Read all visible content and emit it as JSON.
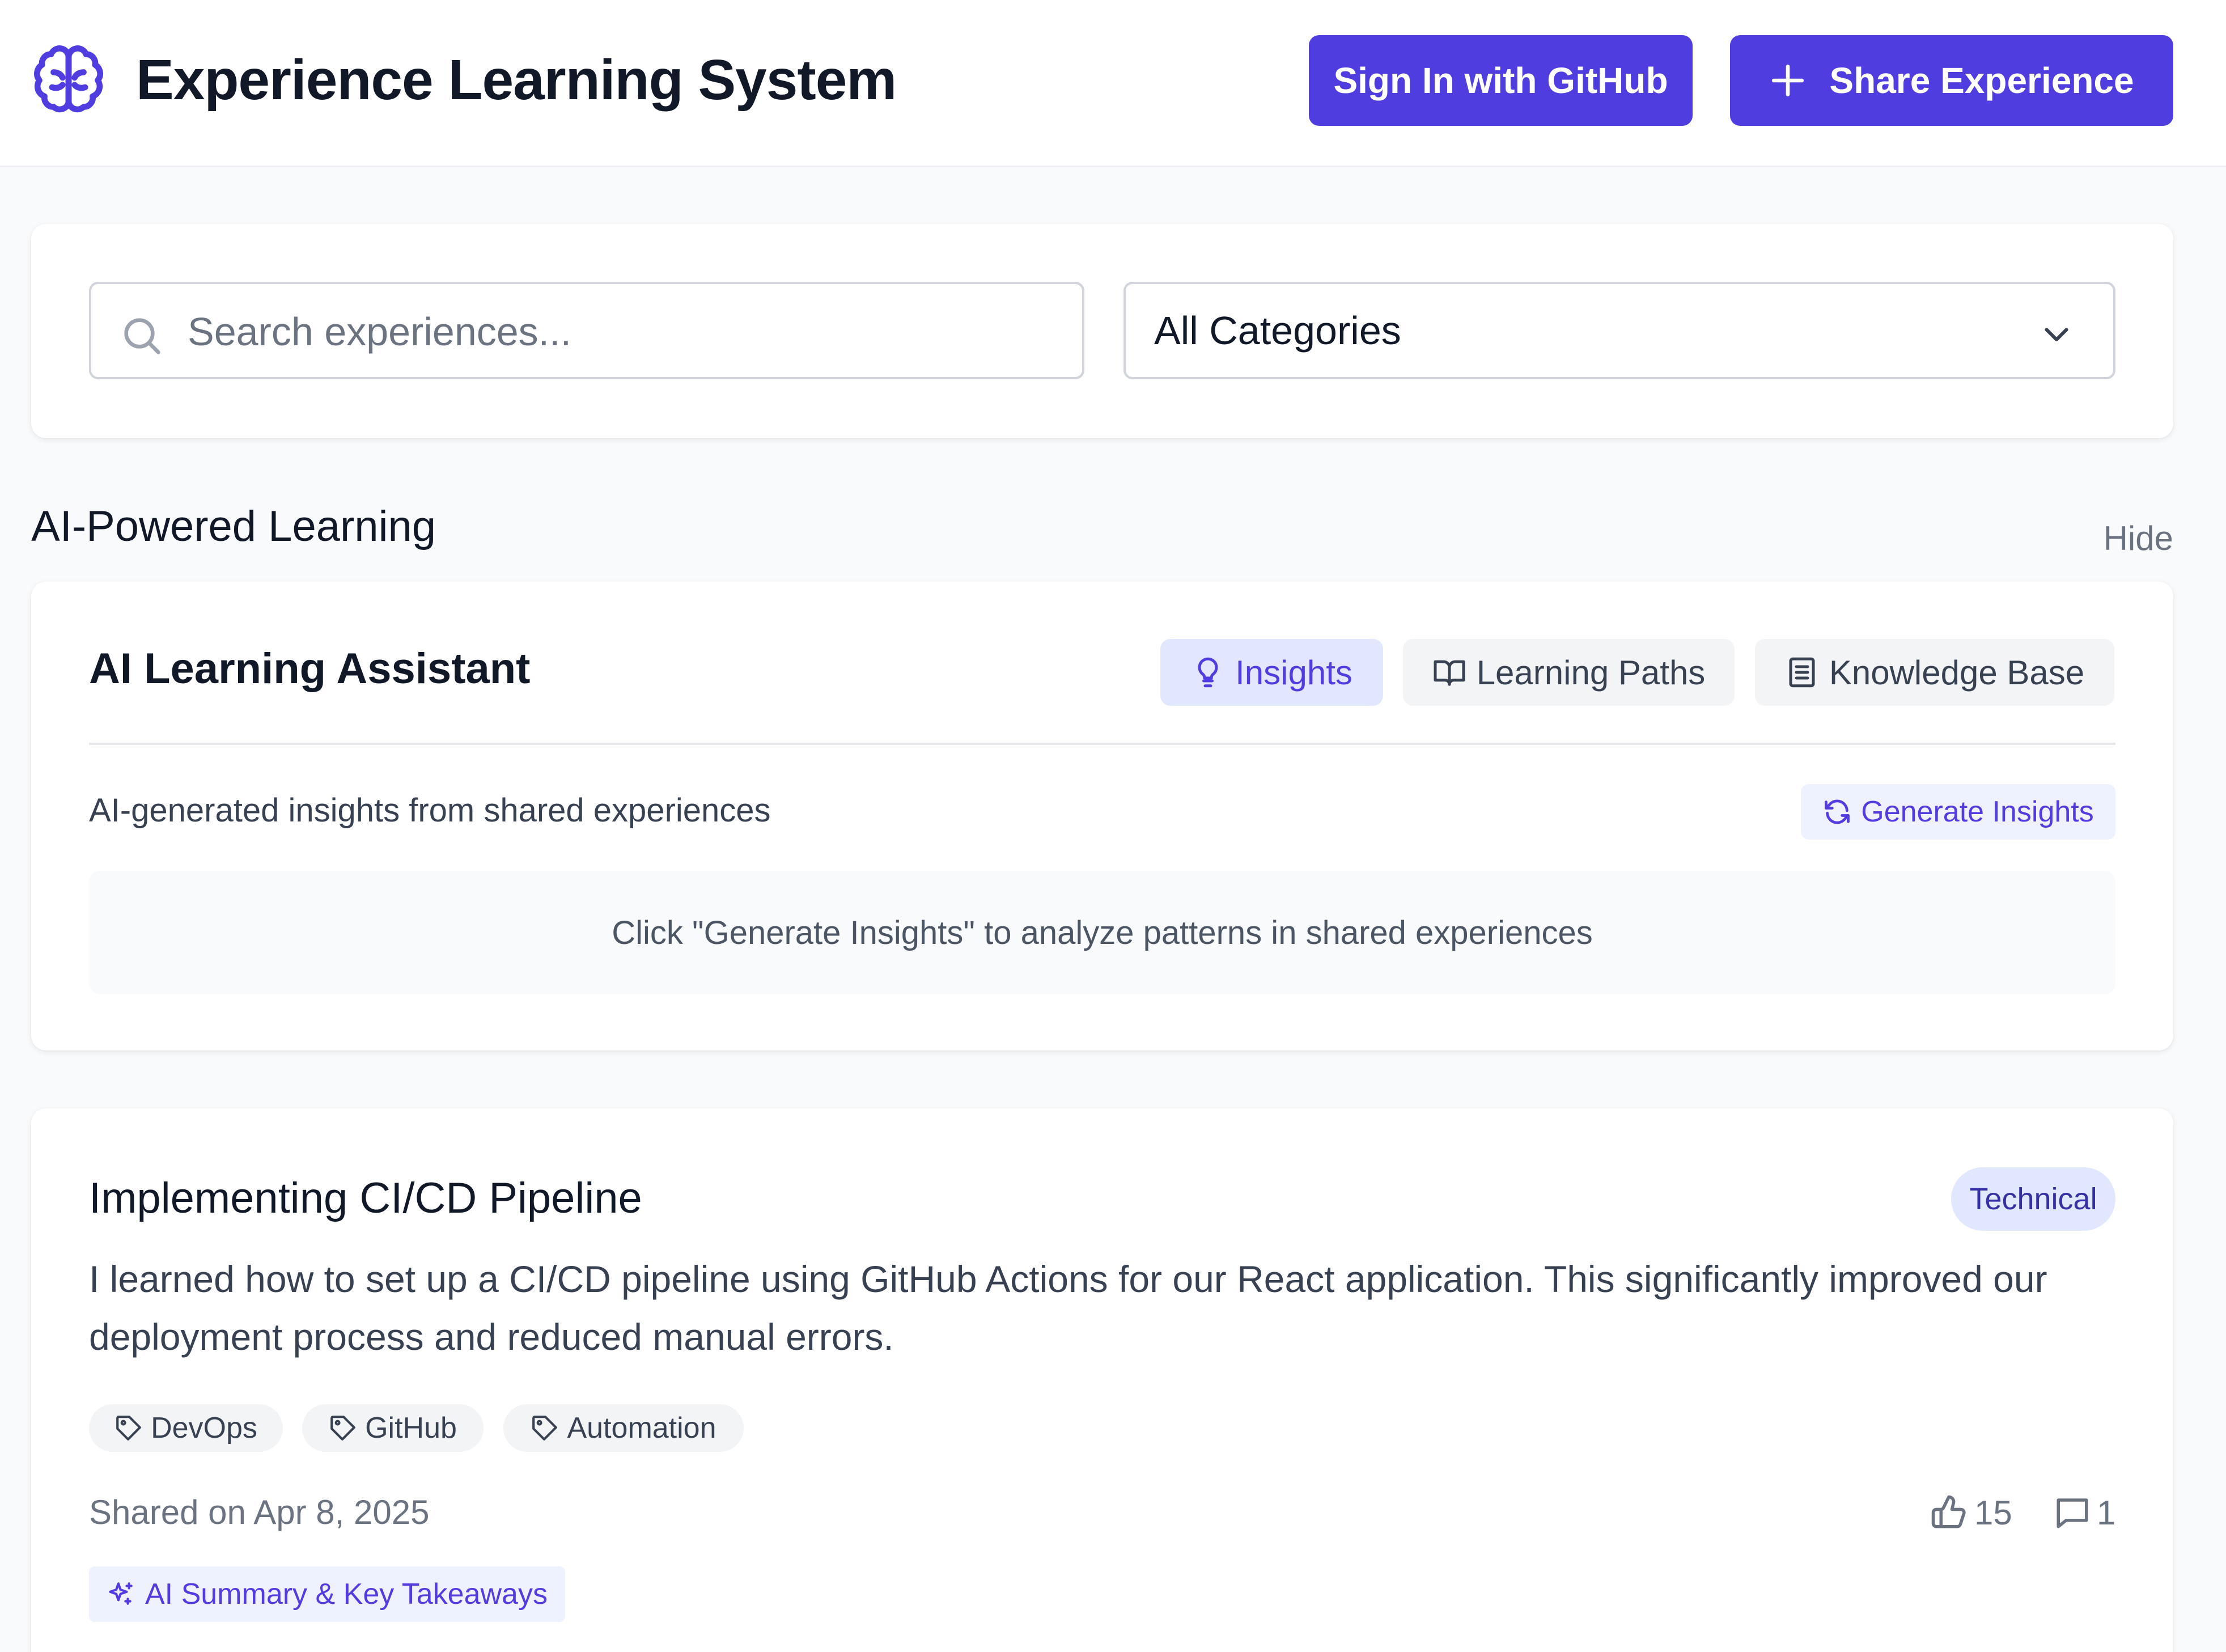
{
  "header": {
    "title": "Experience Learning System",
    "logo_icon": "brain-icon",
    "sign_in_label": "Sign In with GitHub",
    "share_label": "Share Experience"
  },
  "filters": {
    "search_placeholder": "Search experiences...",
    "search_value": "",
    "category_selected": "All Categories"
  },
  "ai_section": {
    "title": "AI-Powered Learning",
    "hide_label": "Hide",
    "assistant_title": "AI Learning Assistant",
    "tabs": [
      {
        "label": "Insights",
        "icon": "lightbulb-icon",
        "active": true
      },
      {
        "label": "Learning Paths",
        "icon": "book-open-icon",
        "active": false
      },
      {
        "label": "Knowledge Base",
        "icon": "document-icon",
        "active": false
      }
    ],
    "description": "AI-generated insights from shared experiences",
    "generate_label": "Generate Insights",
    "empty_message": "Click \"Generate Insights\" to analyze patterns in shared experiences"
  },
  "experiences": [
    {
      "title": "Implementing CI/CD Pipeline",
      "category": "Technical",
      "body": "I learned how to set up a CI/CD pipeline using GitHub Actions for our React application. This significantly improved our deployment process and reduced manual errors.",
      "tags": [
        "DevOps",
        "GitHub",
        "Automation"
      ],
      "shared_on": "Shared on Apr 8, 2025",
      "likes": "15",
      "comments": "1",
      "ai_summary_label": "AI Summary & Key Takeaways"
    }
  ],
  "colors": {
    "accent": "#4f3de0",
    "accent_light": "#e0e7ff",
    "text_primary": "#111827",
    "text_muted": "#6b7280",
    "background": "#f9fafb"
  }
}
